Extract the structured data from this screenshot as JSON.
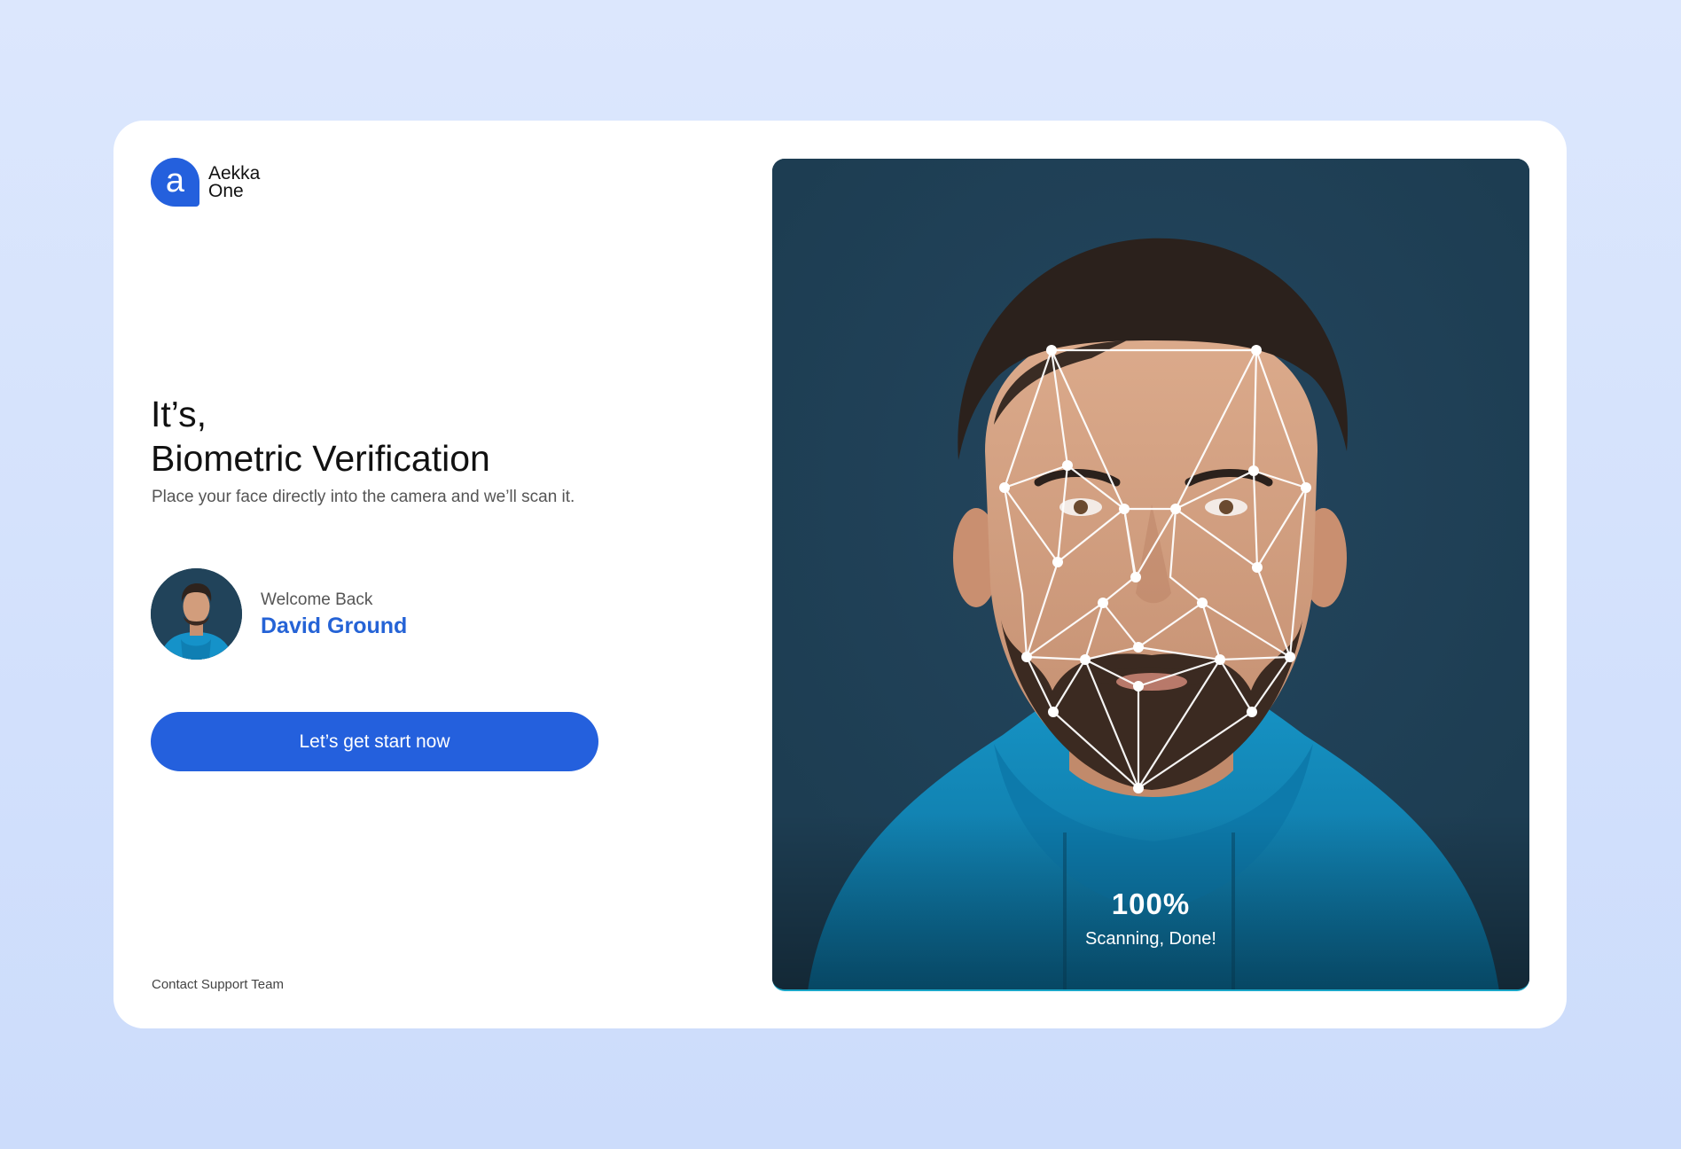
{
  "brand": {
    "logo_letter": "a",
    "name_line1": "Aekka",
    "name_line2": "One",
    "accent": "#2460dd"
  },
  "hero": {
    "line1": "It’s,",
    "line2": "Biometric Verification",
    "subtitle": "Place your face directly into the camera and we’ll scan it."
  },
  "user": {
    "welcome": "Welcome Back",
    "name": "David Ground"
  },
  "cta": {
    "label": "Let’s get start now"
  },
  "footer": {
    "support": "Contact Support Team"
  },
  "scan": {
    "progress_text": "100%",
    "progress_value": 1.0,
    "status": "Scanning, Done!"
  },
  "icons": [
    "logo-mark",
    "face-mesh-overlay"
  ]
}
